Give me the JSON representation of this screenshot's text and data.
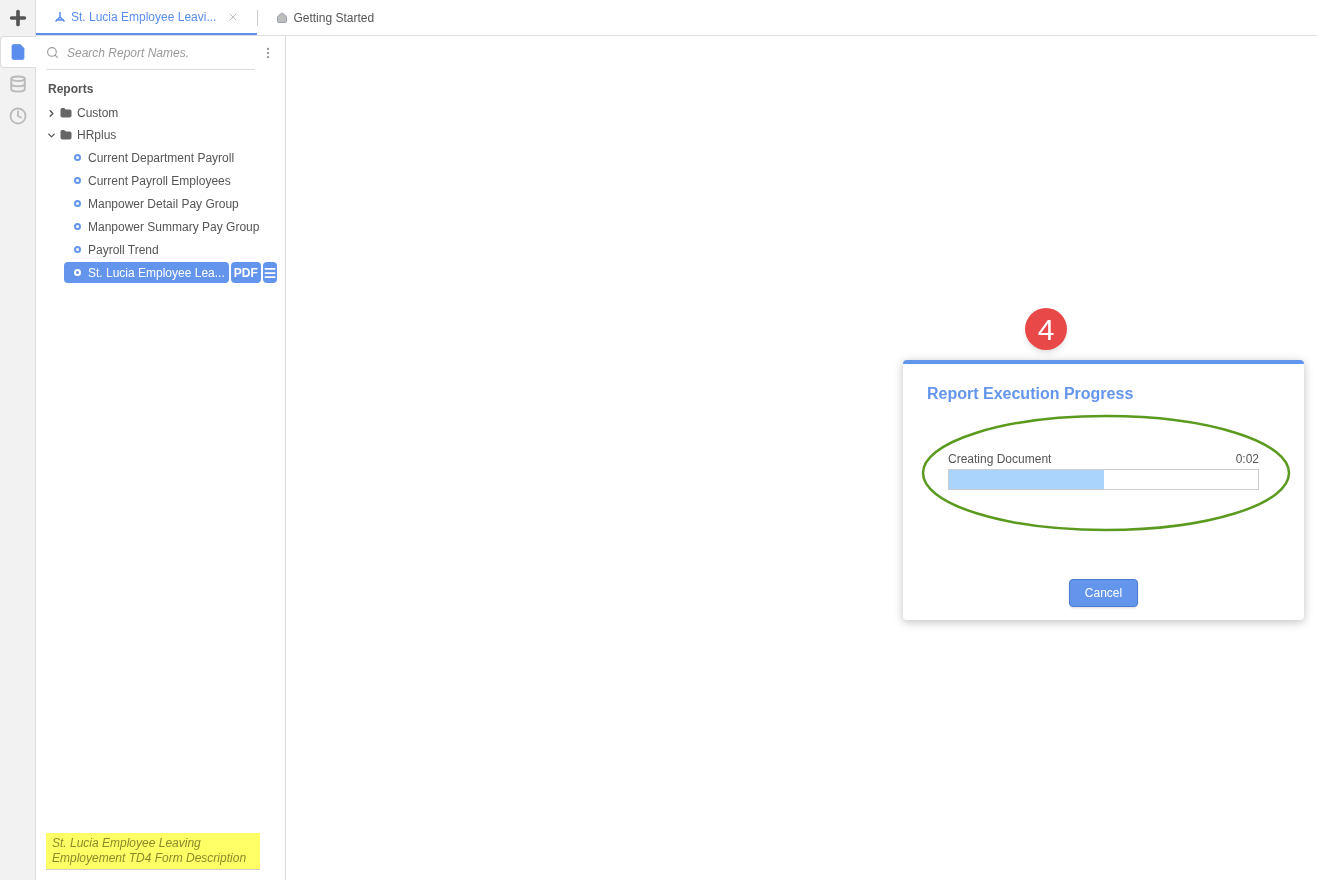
{
  "rail": [
    {
      "kind": "report",
      "selected": true
    },
    {
      "kind": "database",
      "selected": false
    },
    {
      "kind": "history",
      "selected": false
    }
  ],
  "tabs": [
    {
      "kind": "report",
      "label": "St. Lucia Employee Leavi...",
      "selected": true,
      "closable": true
    },
    {
      "kind": "home",
      "label": "Getting Started",
      "selected": false,
      "closable": false
    }
  ],
  "sidebar": {
    "search": {
      "placeholder": "Search Report Names."
    },
    "heading": "Reports",
    "tree": [
      {
        "kind": "folder",
        "label": "Custom",
        "expanded": false
      },
      {
        "kind": "folder",
        "label": "HRplus",
        "expanded": true,
        "children": [
          {
            "kind": "report",
            "label": "Current Department Payroll",
            "selected": false
          },
          {
            "kind": "report",
            "label": "Current Payroll Employees",
            "selected": false
          },
          {
            "kind": "report",
            "label": "Manpower Detail Pay Group",
            "selected": false
          },
          {
            "kind": "report",
            "label": "Manpower Summary Pay Group",
            "selected": false
          },
          {
            "kind": "report",
            "label": "Payroll Trend",
            "selected": false
          },
          {
            "kind": "report",
            "label": "St. Lucia Employee Lea...",
            "selected": true,
            "format": "PDF"
          }
        ]
      }
    ],
    "description": "St. Lucia Employee Leaving Employement TD4 Form Description"
  },
  "dialog": {
    "step_badge": "4",
    "title": "Report Execution Progress",
    "status": "Creating Document",
    "elapsed": "0:02",
    "level": 0.5,
    "cancel": "Cancel"
  }
}
